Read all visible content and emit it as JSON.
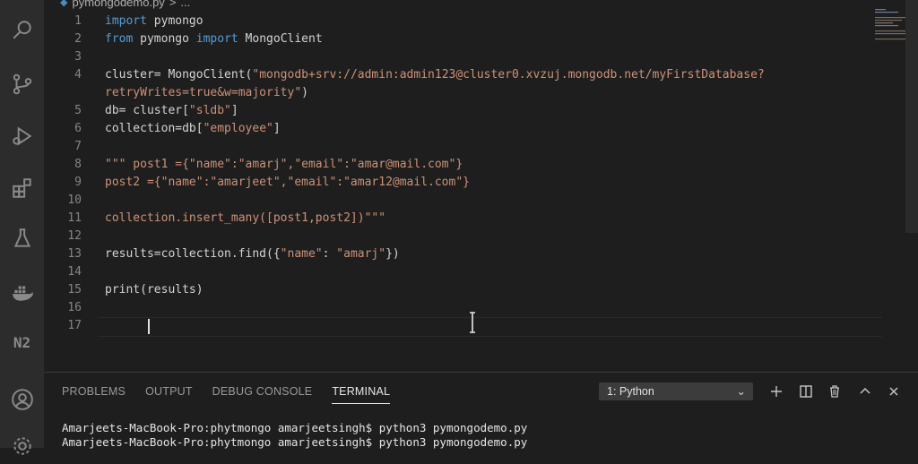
{
  "breadcrumb": {
    "file": "pymongodemo.py",
    "separator": ">",
    "more": "..."
  },
  "code": {
    "lines": [
      {
        "n": "1",
        "parts": [
          {
            "t": "import",
            "c": "kw"
          },
          {
            "t": " pymongo",
            "c": ""
          }
        ]
      },
      {
        "n": "2",
        "parts": [
          {
            "t": "from",
            "c": "kw"
          },
          {
            "t": " pymongo ",
            "c": ""
          },
          {
            "t": "import",
            "c": "kw"
          },
          {
            "t": " MongoClient",
            "c": ""
          }
        ]
      },
      {
        "n": "3",
        "parts": []
      },
      {
        "n": "4",
        "parts": [
          {
            "t": "cluster= MongoClient(",
            "c": ""
          },
          {
            "t": "\"mongodb+srv://admin:admin123@cluster0.xvzuj.mongodb.net/myFirstDatabase?",
            "c": "str"
          }
        ]
      },
      {
        "n": "",
        "parts": [
          {
            "t": "retryWrites=true&w=majority\"",
            "c": "str"
          },
          {
            "t": ")",
            "c": ""
          }
        ]
      },
      {
        "n": "5",
        "parts": [
          {
            "t": "db= cluster[",
            "c": ""
          },
          {
            "t": "\"sldb\"",
            "c": "str"
          },
          {
            "t": "]",
            "c": ""
          }
        ]
      },
      {
        "n": "6",
        "parts": [
          {
            "t": "collection=db[",
            "c": ""
          },
          {
            "t": "\"employee\"",
            "c": "str"
          },
          {
            "t": "]",
            "c": ""
          }
        ]
      },
      {
        "n": "7",
        "parts": []
      },
      {
        "n": "8",
        "parts": [
          {
            "t": "\"\"\" post1 ={\"name\":\"amarj\",\"email\":\"amar@mail.com\"}",
            "c": "str"
          }
        ]
      },
      {
        "n": "9",
        "parts": [
          {
            "t": "post2 ={\"name\":\"amarjeet\",\"email\":\"amar12@mail.com\"}",
            "c": "str"
          }
        ]
      },
      {
        "n": "10",
        "parts": []
      },
      {
        "n": "11",
        "parts": [
          {
            "t": "collection.insert_many([post1,post2])\"\"\"",
            "c": "str"
          }
        ]
      },
      {
        "n": "12",
        "parts": []
      },
      {
        "n": "13",
        "parts": [
          {
            "t": "results=collection.find({",
            "c": ""
          },
          {
            "t": "\"name\"",
            "c": "str"
          },
          {
            "t": ": ",
            "c": ""
          },
          {
            "t": "\"amarj\"",
            "c": "str"
          },
          {
            "t": "})",
            "c": ""
          }
        ]
      },
      {
        "n": "14",
        "parts": []
      },
      {
        "n": "15",
        "parts": [
          {
            "t": "print(results)",
            "c": ""
          }
        ]
      },
      {
        "n": "16",
        "parts": []
      },
      {
        "n": "17",
        "parts": []
      }
    ]
  },
  "panel": {
    "tabs": [
      "PROBLEMS",
      "OUTPUT",
      "DEBUG CONSOLE",
      "TERMINAL"
    ],
    "active_tab": "TERMINAL",
    "terminal_select": "1: Python",
    "terminal_lines": [
      "Amarjeets-MacBook-Pro:phytmongo amarjeetsingh$ python3 pymongodemo.py",
      "Amarjeets-MacBook-Pro:phytmongo amarjeetsingh$ python3 pymongodemo.py"
    ]
  },
  "activity_icons": [
    "search-icon",
    "source-control-icon",
    "run-debug-icon",
    "extensions-icon",
    "testing-flask-icon",
    "docker-icon",
    "n2-icon",
    "account-icon",
    "settings-icon"
  ]
}
